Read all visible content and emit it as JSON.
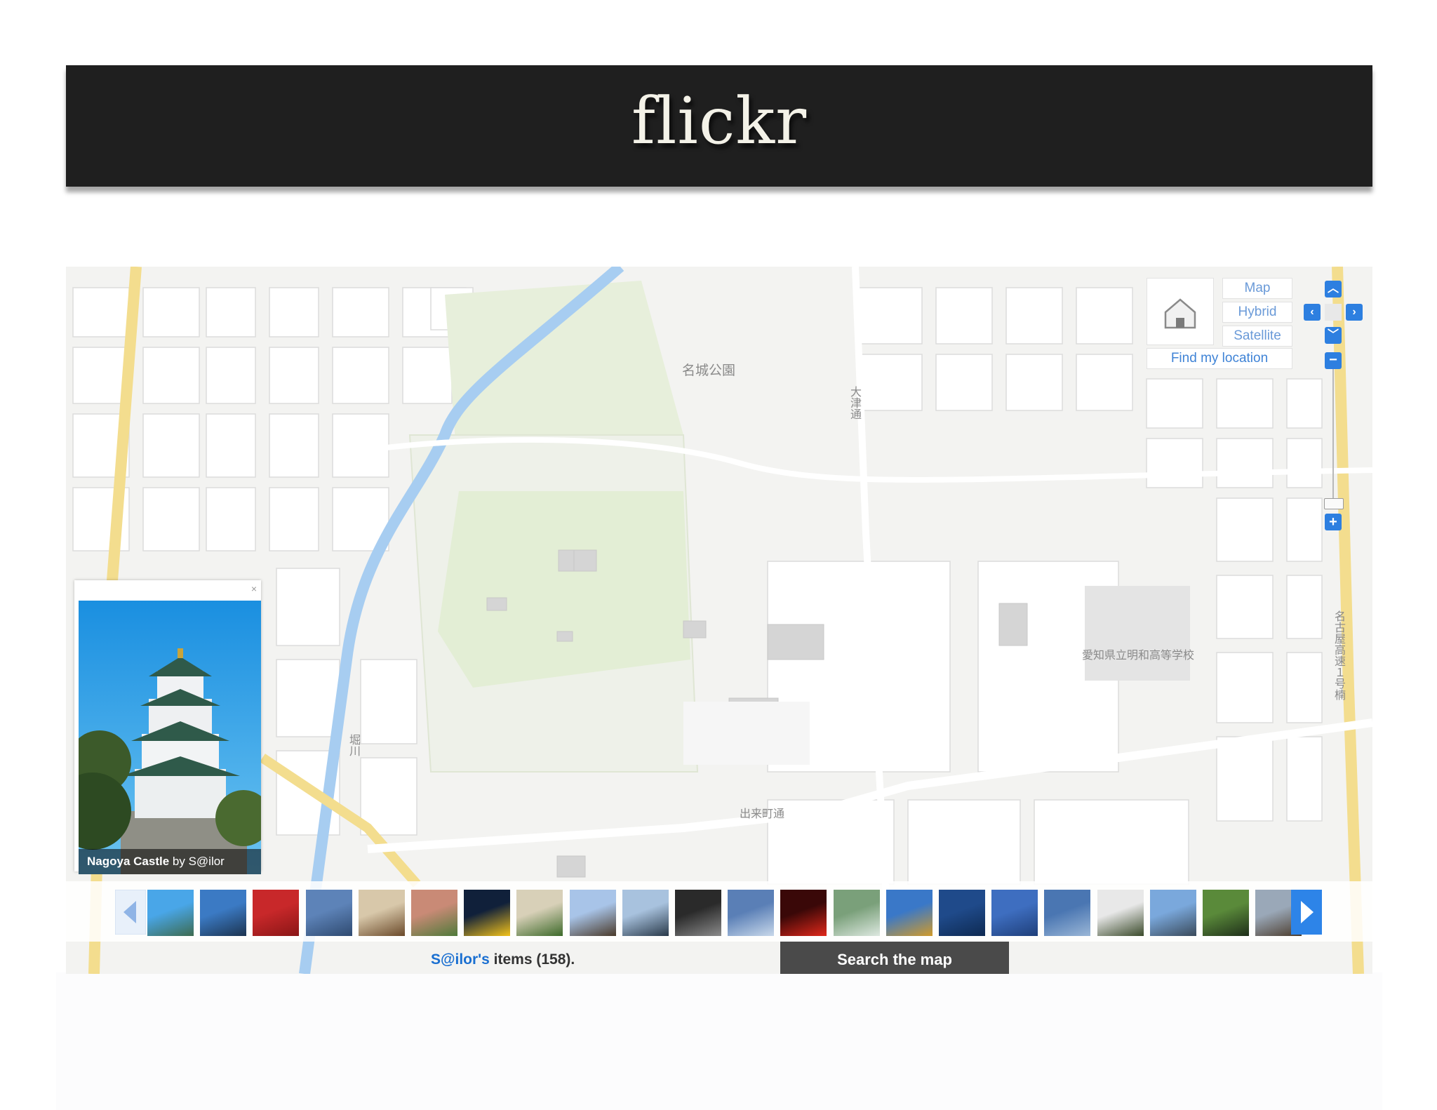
{
  "header": {
    "title": "flickr"
  },
  "map": {
    "labels": {
      "park": "名城公園",
      "school": "愛知県立明和高等学校",
      "street_south": "出来町通",
      "street_vertical": "大津通",
      "road_right": "名古屋高速１号楠",
      "river": "堀川"
    },
    "type_buttons": [
      "Map",
      "Hybrid",
      "Satellite"
    ],
    "find_location": "Find my location",
    "colors": {
      "road_major": "#f3dd8e",
      "park": "#e6efd8",
      "river": "#9ec9f2",
      "block": "#ffffff",
      "grid": "#dadada"
    }
  },
  "popup": {
    "title": "Nagoya Castle",
    "by": " by ",
    "author": "S@ilor",
    "close": "×"
  },
  "filmstrip": {
    "thumb_count": 22
  },
  "status": {
    "user": "S@ilor's",
    "items_text": " items (158).",
    "search_button": "Search the map"
  }
}
